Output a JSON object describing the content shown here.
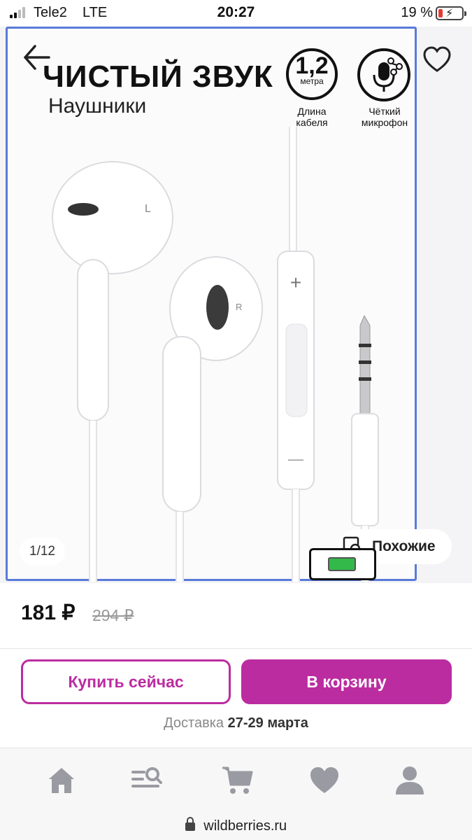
{
  "status_bar": {
    "carrier": "Tele2",
    "network": "LTE",
    "time": "20:27",
    "battery_percent": "19 %",
    "battery_level": 0.19
  },
  "gallery": {
    "hero_title": "ЧИСТЫЙ ЗВУК",
    "hero_subtitle": "Наушники",
    "cable_badge_value": "1,2",
    "cable_badge_unit": "метра",
    "cable_badge_label_line1": "Длина",
    "cable_badge_label_line2": "кабеля",
    "mic_badge_label_line1": "Чёткий",
    "mic_badge_label_line2": "микрофон",
    "earbud_left_mark": "L",
    "earbud_right_mark": "R",
    "remote_plus": "+",
    "remote_minus": "—",
    "counter": "1/12",
    "similar_label": "Похожие"
  },
  "product": {
    "price": "181 ₽",
    "old_price": "294 ₽"
  },
  "actions": {
    "buy_now": "Купить сейчас",
    "add_to_cart": "В корзину"
  },
  "delivery": {
    "label": "Доставка",
    "dates": "27-29 марта"
  },
  "bottom_nav": {
    "items": [
      "home-icon",
      "catalog-search-icon",
      "cart-icon",
      "favorites-icon",
      "profile-icon"
    ]
  },
  "url_bar": {
    "domain": "wildberries.ru"
  },
  "colors": {
    "accent": "#bb2ca0",
    "battery_low": "#e53935",
    "nav_icon": "#9a9aa2",
    "frame_border": "#5a7ad8"
  }
}
